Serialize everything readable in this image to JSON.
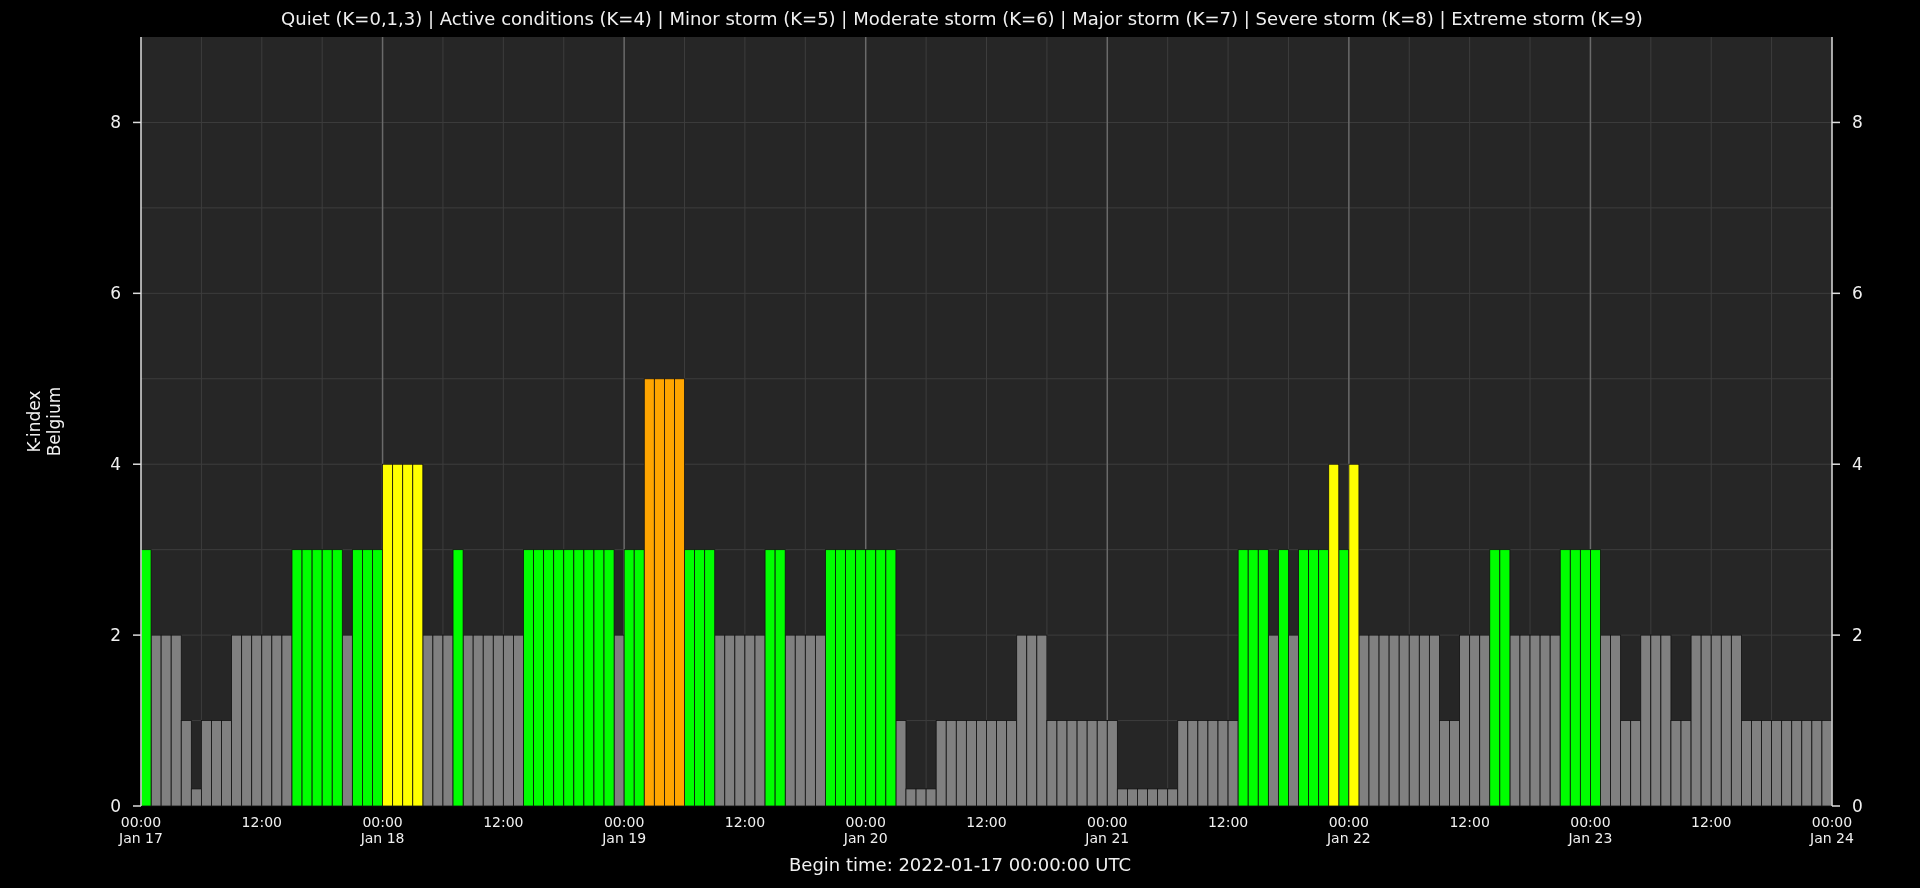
{
  "time_axis": {
    "labels": [
      "00:00\nJan 17",
      "12:00",
      "00:00\nJan 18",
      "12:00",
      "00:00\nJan 19",
      "12:00",
      "00:00\nJan 20",
      "12:00",
      "00:00\nJan 21",
      "12:00",
      "00:00\nJan 22",
      "12:00",
      "00:00\nJan 23",
      "12:00",
      "00:00\nJan 24"
    ]
  },
  "right_axis": {
    "labels": [
      "8",
      "6",
      "4",
      "2",
      "0"
    ]
  },
  "chart_data": {
    "type": "bar",
    "title": "Quiet (K=0,1,3) | Active conditions (K=4) | Minor storm (K=5) | Moderate storm (K=6) | Major storm (K=7) | Severe storm (K=8) | Extreme storm (K=9)",
    "xlabel": "Begin time: 2022-01-17 00:00:00 UTC",
    "ylabel": "K-index\nBelgium",
    "ylim": [
      0,
      9
    ],
    "grid": true,
    "yticks": [
      0,
      2,
      4,
      6,
      8
    ],
    "series": [
      {
        "color": "#808080",
        "values": [
          null,
          2,
          2,
          2,
          1,
          0.2,
          1,
          1,
          1,
          2,
          2,
          2,
          2,
          2,
          2,
          null,
          null,
          null,
          null,
          null,
          2,
          null,
          null,
          null,
          null,
          null,
          null,
          null,
          2,
          2,
          2,
          null,
          2,
          2,
          2,
          2,
          2,
          2,
          null,
          null,
          null,
          null,
          null,
          null,
          null,
          null,
          null,
          2,
          null,
          null,
          null,
          null,
          null,
          null,
          null,
          null,
          null,
          2,
          2,
          2,
          2,
          2,
          null,
          null,
          2,
          2,
          2,
          2,
          null,
          null,
          null,
          null,
          null,
          null,
          null,
          1,
          0.2,
          0.2,
          0.2,
          1,
          1,
          1,
          1,
          1,
          1,
          1,
          1,
          2,
          2,
          2,
          1,
          1,
          1,
          1,
          1,
          1,
          1,
          0.2,
          0.2,
          0.2,
          0.2,
          0.2,
          0.2,
          1,
          1,
          1,
          1,
          1,
          1,
          null,
          null,
          null,
          2,
          null,
          2,
          null,
          null,
          null,
          null,
          null,
          null,
          2,
          2,
          2,
          2,
          2,
          2,
          2,
          2,
          1,
          1,
          2,
          2,
          2,
          null,
          null,
          2,
          2,
          2,
          2,
          2,
          null,
          null,
          null,
          null,
          2,
          2,
          1,
          1,
          2,
          2,
          2,
          1,
          1,
          2,
          2,
          2,
          2,
          2,
          1,
          1,
          1,
          1,
          1,
          1,
          1,
          1,
          1
        ]
      },
      {
        "color": "#00ff00",
        "values": [
          3,
          null,
          null,
          null,
          null,
          null,
          null,
          null,
          null,
          null,
          null,
          null,
          null,
          null,
          null,
          3,
          3,
          3,
          3,
          3,
          null,
          3,
          3,
          3,
          null,
          null,
          null,
          null,
          null,
          null,
          null,
          3,
          null,
          null,
          null,
          null,
          null,
          null,
          3,
          3,
          3,
          3,
          3,
          3,
          3,
          3,
          3,
          null,
          3,
          3,
          null,
          null,
          null,
          null,
          3,
          3,
          3,
          null,
          null,
          null,
          null,
          null,
          3,
          3,
          null,
          null,
          null,
          null,
          3,
          3,
          3,
          3,
          3,
          3,
          3,
          null,
          null,
          null,
          null,
          null,
          null,
          null,
          null,
          null,
          null,
          null,
          null,
          null,
          null,
          null,
          null,
          null,
          null,
          null,
          null,
          null,
          null,
          null,
          null,
          null,
          null,
          null,
          null,
          null,
          null,
          null,
          null,
          null,
          null,
          3,
          3,
          3,
          null,
          3,
          null,
          3,
          3,
          3,
          null,
          3,
          null,
          null,
          null,
          null,
          null,
          null,
          null,
          null,
          null,
          null,
          null,
          null,
          null,
          null,
          3,
          3,
          null,
          null,
          null,
          null,
          null,
          3,
          3,
          3,
          3,
          null,
          null,
          null,
          null,
          null,
          null,
          null,
          null,
          null,
          null,
          null,
          null,
          null,
          null,
          null,
          null,
          null,
          null,
          null,
          null,
          null,
          null,
          null
        ]
      },
      {
        "color": "#ffff00",
        "values": [
          null,
          null,
          null,
          null,
          null,
          null,
          null,
          null,
          null,
          null,
          null,
          null,
          null,
          null,
          null,
          null,
          null,
          null,
          null,
          null,
          null,
          null,
          null,
          null,
          4,
          4,
          4,
          4,
          null,
          null,
          null,
          null,
          null,
          null,
          null,
          null,
          null,
          null,
          null,
          null,
          null,
          null,
          null,
          null,
          null,
          null,
          null,
          null,
          null,
          null,
          null,
          null,
          null,
          null,
          null,
          null,
          null,
          null,
          null,
          null,
          null,
          null,
          null,
          null,
          null,
          null,
          null,
          null,
          null,
          null,
          null,
          null,
          null,
          null,
          null,
          null,
          null,
          null,
          null,
          null,
          null,
          null,
          null,
          null,
          null,
          null,
          null,
          null,
          null,
          null,
          null,
          null,
          null,
          null,
          null,
          null,
          null,
          null,
          null,
          null,
          null,
          null,
          null,
          null,
          null,
          null,
          null,
          null,
          null,
          null,
          null,
          null,
          null,
          null,
          null,
          null,
          null,
          null,
          4,
          null,
          4,
          null,
          null,
          null,
          null,
          null,
          null,
          null,
          null,
          null,
          null,
          null,
          null,
          null,
          null,
          null,
          null,
          null,
          null,
          null,
          null,
          null,
          null,
          null,
          null,
          null,
          null,
          null,
          null,
          null,
          null,
          null,
          null,
          null,
          null,
          null,
          null,
          null,
          null,
          null,
          null,
          null,
          null,
          null,
          null,
          null,
          null,
          null
        ]
      },
      {
        "color": "#ffa500",
        "values": [
          null,
          null,
          null,
          null,
          null,
          null,
          null,
          null,
          null,
          null,
          null,
          null,
          null,
          null,
          null,
          null,
          null,
          null,
          null,
          null,
          null,
          null,
          null,
          null,
          null,
          null,
          null,
          null,
          null,
          null,
          null,
          null,
          null,
          null,
          null,
          null,
          null,
          null,
          null,
          null,
          null,
          null,
          null,
          null,
          null,
          null,
          null,
          null,
          null,
          null,
          5,
          5,
          5,
          5,
          null,
          null,
          null,
          null,
          null,
          null,
          null,
          null,
          null,
          null,
          null,
          null,
          null,
          null,
          null,
          null,
          null,
          null,
          null,
          null,
          null,
          null,
          null,
          null,
          null,
          null,
          null,
          null,
          null,
          null,
          null,
          null,
          null,
          null,
          null,
          null,
          null,
          null,
          null,
          null,
          null,
          null,
          null,
          null,
          null,
          null,
          null,
          null,
          null,
          null,
          null,
          null,
          null,
          null,
          null,
          null,
          null,
          null,
          null,
          null,
          null,
          null,
          null,
          null,
          null,
          null,
          null,
          null,
          null,
          null,
          null,
          null,
          null,
          null,
          null,
          null,
          null,
          null,
          null,
          null,
          null,
          null,
          null,
          null,
          null,
          null,
          null,
          null,
          null,
          null,
          null,
          null,
          null,
          null,
          null,
          null,
          null,
          null,
          null,
          null,
          null,
          null,
          null,
          null,
          null,
          null,
          null,
          null,
          null,
          null,
          null,
          null,
          null,
          null
        ]
      }
    ]
  }
}
